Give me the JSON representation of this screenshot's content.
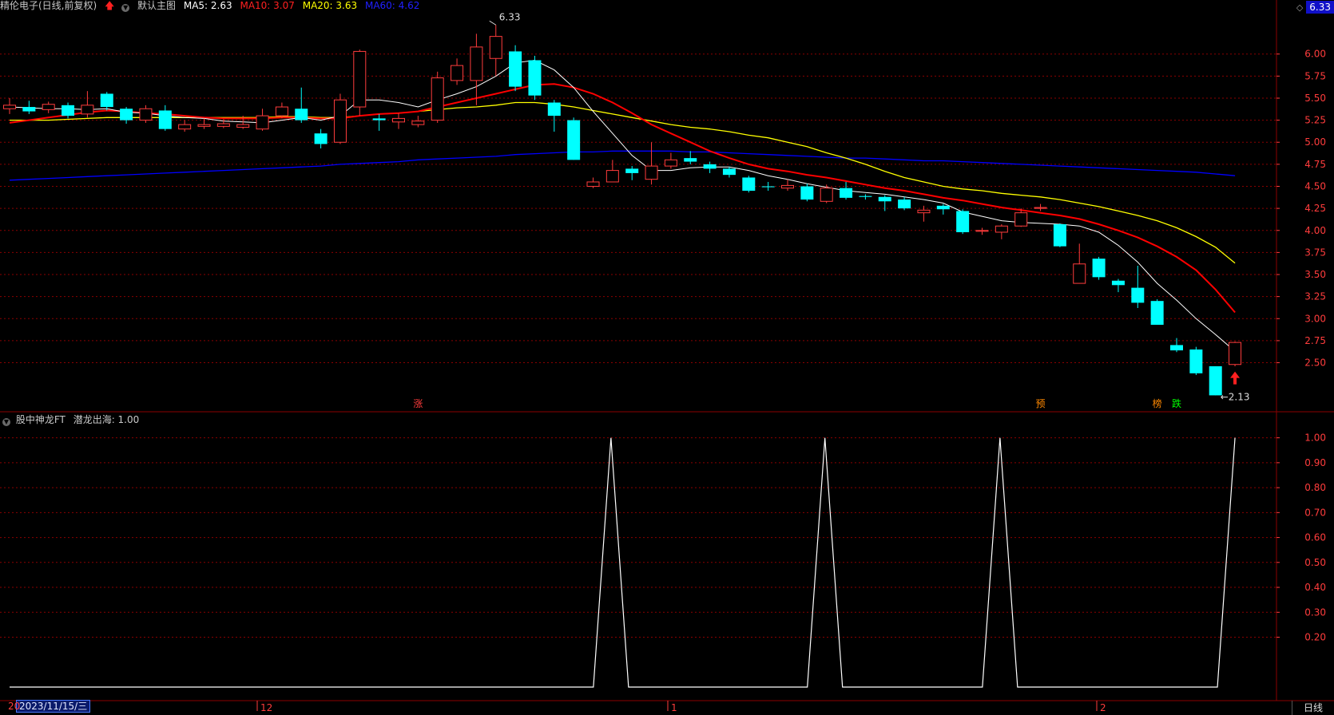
{
  "header": {
    "stock": "精伦电子(日线,前复权)",
    "main_chart": "默认主图",
    "ma5": "MA5: 2.63",
    "ma10": "MA10: 3.07",
    "ma20": "MA20: 3.63",
    "ma60": "MA60: 4.62",
    "current_price": "6.33"
  },
  "indicator": {
    "name": "股中神龙FT",
    "line": "潜龙出海: 1.00"
  },
  "footer": {
    "date_prefix": "20",
    "date_box": "2023/11/15/三",
    "month_labels": [
      "12",
      "1",
      "2"
    ],
    "period": "日线"
  },
  "colors": {
    "up": "#ff3c3c",
    "down": "#00ffff",
    "ma5": "#ffffff",
    "ma10": "#ff0000",
    "ma20": "#ffff00",
    "ma60": "#0000ff",
    "grid": "#8b0000",
    "axis_text": "#ff3c3c"
  },
  "chart_data": {
    "type": "candlestick",
    "price_axis": {
      "ylim": [
        1.98,
        6.45
      ],
      "ticks": [
        6.0,
        5.75,
        5.5,
        5.25,
        5.0,
        4.75,
        4.5,
        4.25,
        4.0,
        3.75,
        3.5,
        3.25,
        3.0,
        2.75,
        2.5
      ]
    },
    "annotations": {
      "high": "6.33",
      "low": "2.13"
    },
    "markers": [
      "涨",
      "预",
      "榜",
      "跌"
    ],
    "candles": [
      [
        5.38,
        5.42,
        5.5,
        5.32
      ],
      [
        5.4,
        5.35,
        5.47,
        5.32
      ],
      [
        5.37,
        5.43,
        5.46,
        5.33
      ],
      [
        5.42,
        5.3,
        5.45,
        5.27
      ],
      [
        5.32,
        5.42,
        5.58,
        5.28
      ],
      [
        5.55,
        5.4,
        5.57,
        5.36
      ],
      [
        5.38,
        5.25,
        5.4,
        5.21
      ],
      [
        5.25,
        5.38,
        5.42,
        5.22
      ],
      [
        5.36,
        5.15,
        5.42,
        5.13
      ],
      [
        5.15,
        5.2,
        5.25,
        5.12
      ],
      [
        5.18,
        5.2,
        5.27,
        5.15
      ],
      [
        5.18,
        5.21,
        5.26,
        5.16
      ],
      [
        5.17,
        5.2,
        5.3,
        5.15
      ],
      [
        5.15,
        5.3,
        5.38,
        5.13
      ],
      [
        5.3,
        5.4,
        5.45,
        5.27
      ],
      [
        5.38,
        5.25,
        5.62,
        5.22
      ],
      [
        5.1,
        4.98,
        5.15,
        4.93
      ],
      [
        5.0,
        5.48,
        5.55,
        4.98
      ],
      [
        5.4,
        6.03,
        6.05,
        5.3
      ],
      [
        5.27,
        5.25,
        5.32,
        5.13
      ],
      [
        5.23,
        5.27,
        5.33,
        5.15
      ],
      [
        5.2,
        5.24,
        5.3,
        5.17
      ],
      [
        5.25,
        5.73,
        5.8,
        5.22
      ],
      [
        5.7,
        5.87,
        5.95,
        5.65
      ],
      [
        5.7,
        6.08,
        6.23,
        5.42
      ],
      [
        5.95,
        6.2,
        6.33,
        5.75
      ],
      [
        6.03,
        5.63,
        6.1,
        5.58
      ],
      [
        5.93,
        5.53,
        5.98,
        5.48
      ],
      [
        5.45,
        5.3,
        5.48,
        5.12
      ],
      [
        5.25,
        4.8,
        5.28,
        4.8
      ],
      [
        4.5,
        4.55,
        4.6,
        4.48
      ],
      [
        4.55,
        4.68,
        4.8,
        4.55
      ],
      [
        4.7,
        4.65,
        4.73,
        4.57
      ],
      [
        4.58,
        4.73,
        5.0,
        4.52
      ],
      [
        4.73,
        4.8,
        4.88,
        4.7
      ],
      [
        4.82,
        4.78,
        4.9,
        4.75
      ],
      [
        4.75,
        4.7,
        4.78,
        4.65
      ],
      [
        4.7,
        4.63,
        4.72,
        4.6
      ],
      [
        4.6,
        4.45,
        4.62,
        4.43
      ],
      [
        4.5,
        4.49,
        4.55,
        4.45
      ],
      [
        4.48,
        4.51,
        4.58,
        4.45
      ],
      [
        4.5,
        4.35,
        4.53,
        4.33
      ],
      [
        4.33,
        4.48,
        4.52,
        4.31
      ],
      [
        4.48,
        4.37,
        4.55,
        4.35
      ],
      [
        4.39,
        4.38,
        4.41,
        4.35
      ],
      [
        4.38,
        4.33,
        4.4,
        4.22
      ],
      [
        4.35,
        4.25,
        4.38,
        4.23
      ],
      [
        4.2,
        4.23,
        4.28,
        4.1
      ],
      [
        4.28,
        4.24,
        4.3,
        4.18
      ],
      [
        4.22,
        3.98,
        4.24,
        3.96
      ],
      [
        3.99,
        4.0,
        4.03,
        3.95
      ],
      [
        3.98,
        4.05,
        4.07,
        3.9
      ],
      [
        4.05,
        4.2,
        4.25,
        4.04
      ],
      [
        4.25,
        4.26,
        4.3,
        4.22
      ],
      [
        4.07,
        3.82,
        4.08,
        3.81
      ],
      [
        3.4,
        3.62,
        3.85,
        3.4
      ],
      [
        3.68,
        3.47,
        3.7,
        3.44
      ],
      [
        3.43,
        3.38,
        3.45,
        3.3
      ],
      [
        3.35,
        3.18,
        3.6,
        3.12
      ],
      [
        3.2,
        2.93,
        3.22,
        2.93
      ],
      [
        2.7,
        2.64,
        2.78,
        2.62
      ],
      [
        2.65,
        2.38,
        2.68,
        2.36
      ],
      [
        2.46,
        2.13,
        2.46,
        2.13
      ],
      [
        2.48,
        2.73,
        2.74,
        2.46
      ]
    ],
    "ma5": [
      5.4,
      5.39,
      5.38,
      5.38,
      5.37,
      5.38,
      5.34,
      5.33,
      5.3,
      5.28,
      5.27,
      5.24,
      5.23,
      5.22,
      5.25,
      5.28,
      5.25,
      5.3,
      5.48,
      5.48,
      5.45,
      5.4,
      5.48,
      5.55,
      5.63,
      5.75,
      5.9,
      5.93,
      5.82,
      5.62,
      5.35,
      5.1,
      4.85,
      4.68,
      4.68,
      4.71,
      4.72,
      4.72,
      4.68,
      4.62,
      4.58,
      4.53,
      4.49,
      4.45,
      4.43,
      4.41,
      4.38,
      4.35,
      4.31,
      4.21,
      4.16,
      4.11,
      4.09,
      4.08,
      4.07,
      4.05,
      3.98,
      3.83,
      3.64,
      3.4,
      3.21,
      3.0,
      2.82,
      2.63
    ],
    "ma10": [
      5.22,
      5.25,
      5.28,
      5.31,
      5.34,
      5.36,
      5.35,
      5.33,
      5.32,
      5.3,
      5.28,
      5.27,
      5.27,
      5.27,
      5.28,
      5.28,
      5.27,
      5.27,
      5.3,
      5.32,
      5.33,
      5.35,
      5.4,
      5.45,
      5.5,
      5.55,
      5.6,
      5.65,
      5.66,
      5.62,
      5.55,
      5.45,
      5.33,
      5.2,
      5.1,
      5.0,
      4.9,
      4.82,
      4.75,
      4.7,
      4.67,
      4.63,
      4.6,
      4.56,
      4.52,
      4.48,
      4.45,
      4.41,
      4.37,
      4.34,
      4.3,
      4.26,
      4.23,
      4.2,
      4.17,
      4.13,
      4.07,
      4.0,
      3.92,
      3.82,
      3.7,
      3.55,
      3.33,
      3.07
    ],
    "ma20": [
      5.25,
      5.25,
      5.25,
      5.26,
      5.27,
      5.28,
      5.28,
      5.28,
      5.28,
      5.28,
      5.28,
      5.28,
      5.28,
      5.28,
      5.29,
      5.29,
      5.28,
      5.28,
      5.3,
      5.32,
      5.33,
      5.35,
      5.37,
      5.39,
      5.4,
      5.42,
      5.45,
      5.45,
      5.43,
      5.4,
      5.36,
      5.32,
      5.28,
      5.24,
      5.2,
      5.17,
      5.15,
      5.12,
      5.08,
      5.05,
      5.0,
      4.95,
      4.88,
      4.82,
      4.75,
      4.67,
      4.6,
      4.55,
      4.5,
      4.47,
      4.45,
      4.42,
      4.4,
      4.38,
      4.35,
      4.31,
      4.27,
      4.22,
      4.17,
      4.11,
      4.03,
      3.93,
      3.81,
      3.63
    ],
    "ma60": [
      4.57,
      4.58,
      4.59,
      4.6,
      4.61,
      4.62,
      4.63,
      4.64,
      4.65,
      4.66,
      4.67,
      4.68,
      4.69,
      4.7,
      4.71,
      4.72,
      4.73,
      4.75,
      4.76,
      4.77,
      4.78,
      4.8,
      4.81,
      4.82,
      4.83,
      4.84,
      4.86,
      4.87,
      4.88,
      4.89,
      4.89,
      4.9,
      4.9,
      4.9,
      4.9,
      4.89,
      4.89,
      4.88,
      4.87,
      4.86,
      4.85,
      4.84,
      4.83,
      4.82,
      4.82,
      4.81,
      4.8,
      4.79,
      4.79,
      4.78,
      4.77,
      4.76,
      4.75,
      4.74,
      4.73,
      4.72,
      4.71,
      4.7,
      4.69,
      4.68,
      4.67,
      4.66,
      4.64,
      4.62
    ],
    "indicator_axis": {
      "ylim": [
        0,
        1.05
      ],
      "ticks": [
        "1.00",
        "0.90",
        "0.80",
        "0.70",
        "0.60",
        "0.50",
        "0.40",
        "0.30",
        "0.20"
      ]
    },
    "indicator_values": [
      0,
      0,
      0,
      0,
      0,
      0,
      0,
      0,
      0,
      0,
      0,
      0,
      0,
      0,
      0,
      0,
      0,
      0,
      0,
      0,
      0,
      0,
      0,
      0,
      0,
      0,
      0,
      0,
      0,
      0,
      0,
      1,
      0,
      0,
      0,
      0,
      0,
      0,
      0,
      0,
      0,
      0,
      0,
      0,
      0,
      0,
      0,
      0,
      0,
      0,
      0,
      0,
      0,
      0,
      0,
      0,
      0,
      0,
      0,
      0,
      0,
      0,
      0,
      1
    ]
  }
}
